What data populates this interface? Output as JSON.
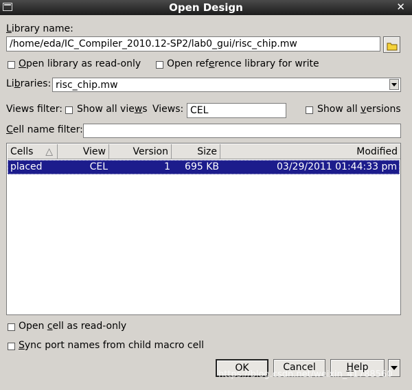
{
  "window": {
    "title": "Open Design",
    "close_glyph": "✕"
  },
  "library": {
    "label_u": "L",
    "label_rest": "ibrary name:",
    "value": "/home/eda/IC_Compiler_2010.12-SP2/lab0_gui/risc_chip.mw",
    "browse_icon": "folder-icon"
  },
  "options": {
    "readonly_u": "O",
    "readonly_rest": "pen library as read-only",
    "openref_pre": "Open ref",
    "openref_u": "e",
    "openref_rest": "rence library for write"
  },
  "libraries": {
    "label_pre": "Li",
    "label_u": "b",
    "label_rest": "raries:",
    "value": "risc_chip.mw"
  },
  "views": {
    "filter_label": "Views filter:",
    "showall_pre": "Show all vie",
    "showall_u": "w",
    "showall_rest": "s",
    "views_label": "Views:",
    "views_value": "CEL",
    "showversions_pre": "Show all ",
    "showversions_u": "v",
    "showversions_rest": "ersions"
  },
  "cellfilter": {
    "label_u": "C",
    "label_rest": "ell name filter:",
    "value": ""
  },
  "table": {
    "headers": {
      "cells": "Cells",
      "view": "View",
      "version": "Version",
      "size": "Size",
      "modified": "Modified"
    },
    "sort_glyph": "△",
    "rows": [
      {
        "cells": "placed",
        "view": "CEL",
        "version": "1",
        "size": "695 KB",
        "modified": "03/29/2011 01:44:33 pm"
      }
    ]
  },
  "bottom": {
    "opencell_pre": "Open ",
    "opencell_u": "c",
    "opencell_rest": "ell as read-only",
    "sync_u": "S",
    "sync_rest": "ync port names from child macro cell"
  },
  "buttons": {
    "ok": "OK",
    "cancel": "Cancel",
    "help_u": "H",
    "help_rest": "elp"
  },
  "watermark": "https://blog.csdn.net/weixin_41788560"
}
